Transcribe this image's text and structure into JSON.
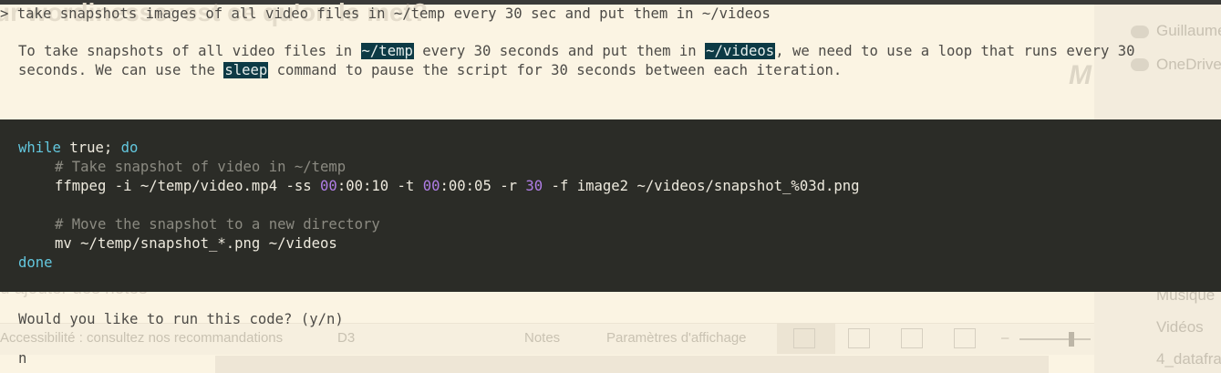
{
  "background": {
    "title_fragment": "ur wordinesse: est ce qu'on le met?",
    "notes_fragment": "u ajouter des notes",
    "logo_fragment": "M",
    "right_panel": [
      "Guillaume",
      "OneDrive",
      "Musique",
      "Vidéos",
      "4_datafra"
    ],
    "statusbar": {
      "accessibility": "Accessibilité : consultez nos recommandations",
      "language": "D3",
      "notes": "Notes",
      "display_settings": "Paramètres d'affichage",
      "zoom_minus": "–"
    }
  },
  "terminal": {
    "prompt_symbol": ">",
    "prompt_text": "take snapshots images of all video files in ~/temp every 30 sec and put them in ~/videos",
    "explanation": {
      "p1_a": "To take snapshots of all video files in ",
      "p1_hl1": "~/temp",
      "p1_b": " every 30 seconds and put them in ",
      "p1_hl2": "~/videos",
      "p1_c": ", we need to use a loop that runs every 30",
      "p2_a": "seconds. We can use the ",
      "p2_hl": "sleep",
      "p2_b": " command to pause the script for 30 seconds between each iteration."
    },
    "code": {
      "l1_kw1": "while",
      "l1_mid": " true; ",
      "l1_kw2": "do",
      "l2_comment": "# Take snapshot of video in ~/temp",
      "l3_a": "ffmpeg -i ~/temp/video.mp4 -ss ",
      "l3_n1": "00",
      "l3_b": ":00:10 -t ",
      "l3_n2": "00",
      "l3_c": ":00:05 -r ",
      "l3_n3": "30",
      "l3_d": " -f image2 ~/videos/snapshot_%03d.png",
      "l5_comment": "# Move the snapshot to a new directory",
      "l6": "mv ~/temp/snapshot_*.png ~/videos",
      "l7_kw": "done"
    },
    "question": "Would you like to run this code? (y/n)",
    "answer": "n"
  }
}
